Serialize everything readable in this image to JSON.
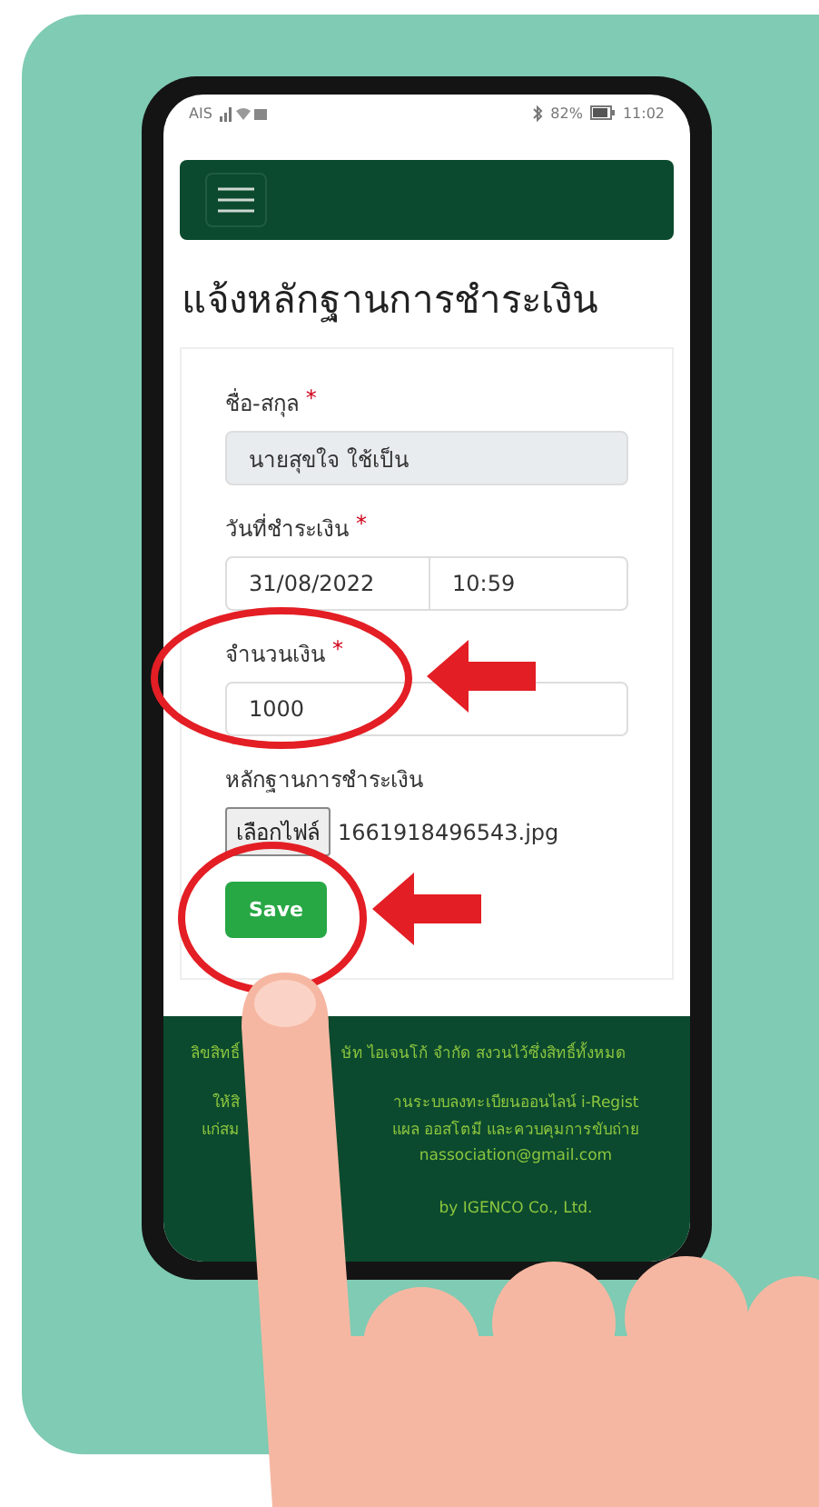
{
  "status_bar": {
    "carrier": "AIS",
    "battery": "82%",
    "time": "11:02"
  },
  "page_title": "แจ้งหลักฐานการชำระเงิน",
  "form": {
    "fields": [
      {
        "kind": "text",
        "label": "ชื่อ-สกุล",
        "required_mark": "*",
        "value": "นายสุขใจ ใช้เป็น",
        "disabled": true
      },
      {
        "kind": "datetime",
        "label": "วันที่ชำระเงิน",
        "required_mark": "*",
        "date": "31/08/2022",
        "time": "10:59"
      },
      {
        "kind": "text",
        "label": "จำนวนเงิน",
        "required_mark": "*",
        "value": "1000",
        "disabled": false
      },
      {
        "kind": "file",
        "label": "หลักฐานการชำระเงิน",
        "button": "เลือกไฟล์",
        "file_name": "1661918496543.jpg"
      }
    ],
    "submit": "Save"
  },
  "footer": {
    "lines": [
      {
        "left": "ลิขสิทธิ์",
        "right": "ษัท ไอเจนโก้ จำกัด สงวนไว้ซึ่งสิทธิ์ทั้งหมด"
      },
      {
        "left": "ให้สิ",
        "right": "านระบบลงทะเบียนออนไลน์ i-Regist"
      },
      {
        "left": "แก่สม",
        "right": "แผล ออสโตมี และควบคุมการขับถ่าย"
      },
      {
        "right": "nassociation@gmail.com"
      },
      {
        "right": "by IGENCO Co., Ltd."
      }
    ]
  }
}
